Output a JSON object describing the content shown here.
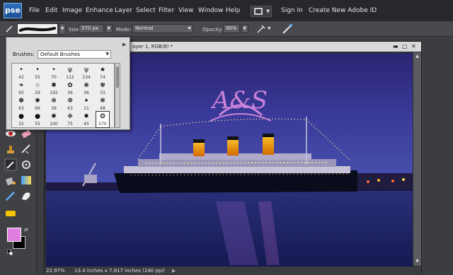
{
  "app": {
    "logo_text": "pse"
  },
  "menu": {
    "items": [
      "File",
      "Edit",
      "Image",
      "Enhance",
      "Layer",
      "Select",
      "Filter",
      "View",
      "Window",
      "Help"
    ],
    "sign_in": "Sign In",
    "create_id": "Create New Adobe ID"
  },
  "options": {
    "size_label": "Size:",
    "size_value": "570 px",
    "mode_label": "Mode:",
    "mode_value": "Normal",
    "opacity_label": "Opacity:",
    "opacity_value": "90%"
  },
  "document": {
    "title": "ayer 1, RGB/8) *",
    "zoom": "22.97%",
    "doc_info": "13.4 inches x 7.817 inches (240 ppi)"
  },
  "brushes": {
    "label": "Brushes:",
    "set": "Default Brushes",
    "sizes": [
      [
        "42",
        "55",
        "70",
        "112",
        "134",
        "74"
      ],
      [
        "95",
        "29",
        "192",
        "36",
        "36",
        "33"
      ],
      [
        "63",
        "66",
        "39",
        "63",
        "11",
        "48"
      ],
      [
        "32",
        "55",
        "100",
        "75",
        "45",
        "570"
      ]
    ]
  },
  "watermark": {
    "monogram": "A&S"
  },
  "colors": {
    "foreground": "#e07fe0",
    "background": "#000000",
    "accent": "#c46fd4"
  }
}
